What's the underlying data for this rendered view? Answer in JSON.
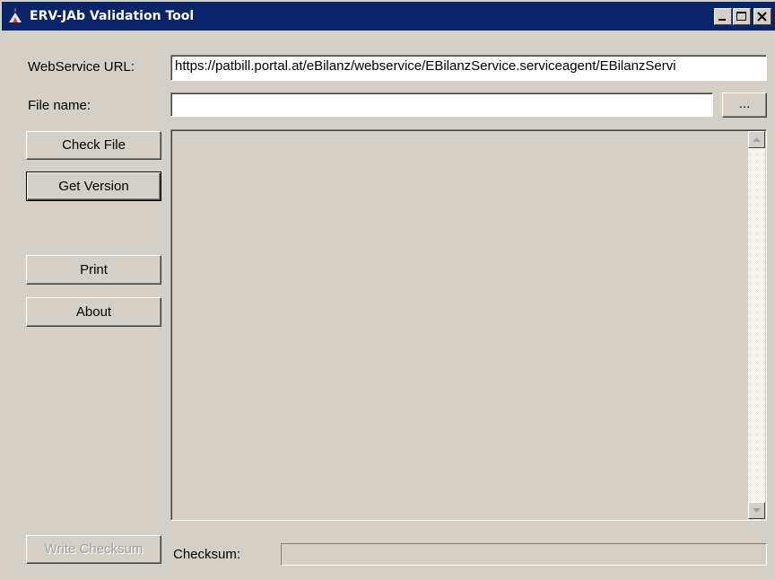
{
  "window": {
    "title": "ERV-JAb Validation Tool",
    "app_icon": "java-cup-icon",
    "controls": [
      "minimize-icon",
      "maximize-icon",
      "close-icon"
    ],
    "titlebar_color": "#0a246a"
  },
  "form": {
    "url_label": "WebService URL:",
    "url_value": "https://patbill.portal.at/eBilanz/webservice/EBilanzService.serviceagent/EBilanzServi",
    "file_label": "File name:",
    "file_value": "",
    "browse_label": "...",
    "checksum_label": "Checksum:",
    "checksum_value": ""
  },
  "buttons": {
    "check_file": "Check File",
    "get_version": "Get Version",
    "print": "Print",
    "about": "About",
    "write_checksum": "Write Checksum"
  },
  "output": {
    "text": ""
  }
}
